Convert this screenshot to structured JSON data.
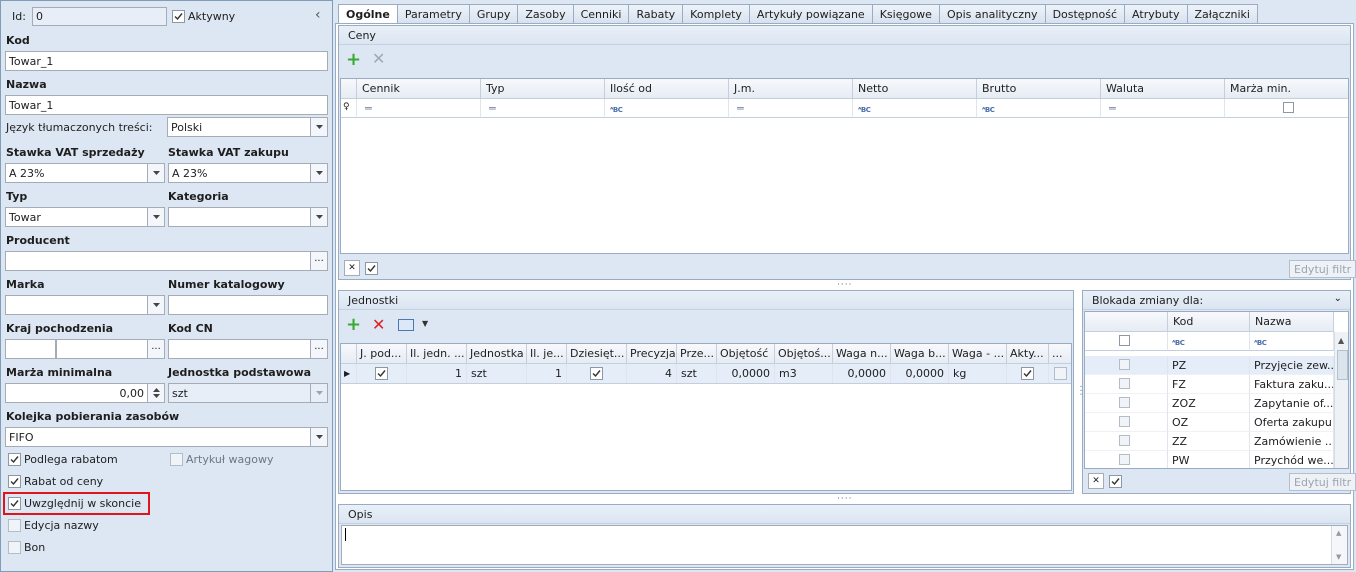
{
  "left": {
    "id_label": "Id:",
    "id_value": "0",
    "aktywny_label": "Aktywny",
    "kod_label": "Kod",
    "kod_value": "Towar_1",
    "nazwa_label": "Nazwa",
    "nazwa_value": "Towar_1",
    "jezyk_label": "Język tłumaczonych treści:",
    "jezyk_value": "Polski",
    "vat_sprz_label": "Stawka VAT sprzedaży",
    "vat_sprz_value": "A 23%",
    "vat_zak_label": "Stawka VAT zakupu",
    "vat_zak_value": "A 23%",
    "typ_label": "Typ",
    "typ_value": "Towar",
    "kategoria_label": "Kategoria",
    "kategoria_value": "",
    "producent_label": "Producent",
    "producent_value": "",
    "marka_label": "Marka",
    "marka_value": "",
    "numer_kat_label": "Numer katalogowy",
    "numer_kat_value": "",
    "kraj_label": "Kraj pochodzenia",
    "kod_cn_label": "Kod CN",
    "marza_label": "Marża minimalna",
    "marza_value": "0,00",
    "jedn_podst_label": "Jednostka podstawowa",
    "jedn_podst_value": "szt",
    "kolejka_label": "Kolejka pobierania zasobów",
    "kolejka_value": "FIFO",
    "podlega_rabatom": "Podlega rabatom",
    "artykul_wagowy": "Artykuł wagowy",
    "rabat_od_ceny": "Rabat od ceny",
    "uwzglednij": "Uwzględnij w skoncie",
    "edycja_nazwy": "Edycja nazwy",
    "bon": "Bon"
  },
  "tabs": [
    "Ogólne",
    "Parametry",
    "Grupy",
    "Zasoby",
    "Cenniki",
    "Rabaty",
    "Komplety",
    "Artykuły powiązane",
    "Księgowe",
    "Opis analityczny",
    "Dostępność",
    "Atrybuty",
    "Załączniki"
  ],
  "ceny": {
    "title": "Ceny",
    "columns": [
      "Cennik",
      "Typ",
      "Ilość od",
      "J.m.",
      "Netto",
      "Brutto",
      "Waluta",
      "Marża min."
    ],
    "filter_button": "Edytuj filtr"
  },
  "jednostki": {
    "title": "Jednostki",
    "columns": [
      "J. pod...",
      "Il. jedn. ...",
      "Jednostka",
      "Il. je...",
      "Dziesięt...",
      "Precyzja",
      "Prze...",
      "Objętość",
      "Objętoś...",
      "Waga n...",
      "Waga b...",
      "Waga - ...",
      "Akty...",
      "..."
    ],
    "row": [
      "",
      "1",
      "szt",
      "1",
      "",
      "4",
      "szt",
      "0,0000",
      "m3",
      "0,0000",
      "0,0000",
      "kg",
      "",
      ""
    ]
  },
  "blokada": {
    "title": "Blokada zmiany dla:",
    "columns": [
      "Kod",
      "Nazwa"
    ],
    "rows": [
      {
        "kod": "PZ",
        "nazwa": "Przyjęcie zew..."
      },
      {
        "kod": "FZ",
        "nazwa": "Faktura zaku..."
      },
      {
        "kod": "ZOZ",
        "nazwa": "Zapytanie of..."
      },
      {
        "kod": "OZ",
        "nazwa": "Oferta zakupu"
      },
      {
        "kod": "ZZ",
        "nazwa": "Zamówienie ..."
      },
      {
        "kod": "PW",
        "nazwa": "Przychód we..."
      }
    ],
    "filter_button": "Edytuj filtr"
  },
  "opis": {
    "title": "Opis"
  },
  "colors": {
    "highlight_border": "#e0151c",
    "accent_green": "#3aa832",
    "delete_red": "#e02020"
  }
}
